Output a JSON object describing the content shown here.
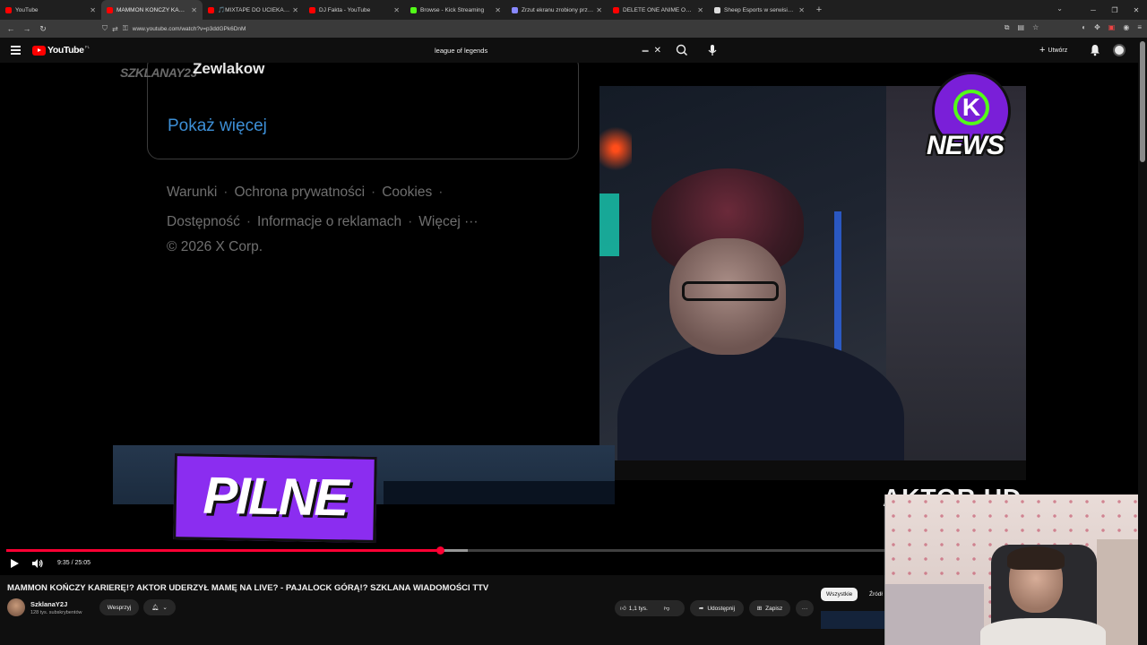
{
  "browser": {
    "tabs": [
      {
        "title": "YouTube",
        "fav": "#ff0000"
      },
      {
        "title": "MAMMON KOŃCZY KARIERĘ!?",
        "fav": "#ff0000",
        "active": true
      },
      {
        "title": "🎵MIXTAPE DO UCIEKANIA",
        "fav": "#ff0000"
      },
      {
        "title": "DJ Fakta - YouTube",
        "fav": "#ff0000"
      },
      {
        "title": "Browse - Kick Streaming",
        "fav": "#53fc18"
      },
      {
        "title": "Zrzut ekranu zrobiony przez Lig",
        "fav": "#8888ff"
      },
      {
        "title": "DELETE ONE ANIME OPENING",
        "fav": "#ff0000"
      },
      {
        "title": "Sheep Esports w serwisie X: „St",
        "fav": "#dddddd"
      }
    ],
    "new_tab": "+",
    "url": "www.youtube.com/watch?v=p3ddGPk6DnM"
  },
  "youtube": {
    "logo_text": "YouTube",
    "country": "PL",
    "search_query": "league of legends",
    "create_label": "Utwórz"
  },
  "video_overlay": {
    "x_name": "Zewlakow",
    "watermark": "SZKLANAY2J",
    "show_more": "Pokaż więcej",
    "footer_row1": [
      "Warunki",
      "Ochrona prywatności",
      "Cookies"
    ],
    "footer_row2": [
      "Dostępność",
      "Informacje o reklamach",
      "Więcej ···"
    ],
    "copyright": "© 2026 X Corp.",
    "pilne": "PILNE",
    "news_label": "NEWS",
    "ticker": "AKTOR UD"
  },
  "player": {
    "time": "9:35 / 25:05",
    "played_fraction": 0.383,
    "buffered_fraction": 0.408
  },
  "meta": {
    "title": "MAMMON KOŃCZY KARIERĘ!? AKTOR UDERZYŁ MAMĘ NA LIVE? - PAJALOCK GÓRĄ!? SZKLANA WIADOMOŚCI TTV",
    "channel": "SzklanaY2J",
    "subs": "128 tys. subskrybentów",
    "support": "Wesprzyj",
    "likes": "1,1 tys.",
    "share": "Udostępnij",
    "save": "Zapisz",
    "more": "···",
    "chip_all": "Wszystkie",
    "chip_sources": "Źródł"
  },
  "colors": {
    "accent": "#ff0033",
    "link": "#3d8fd6",
    "kick": "#53fc18",
    "pilne_bg": "#8b2df0"
  }
}
